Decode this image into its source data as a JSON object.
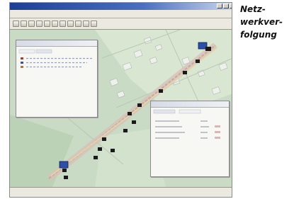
{
  "caption": {
    "lines": [
      "Netz-",
      "werkver-",
      "folgung"
    ]
  },
  "window": {
    "title": "",
    "menu": [
      "",
      "",
      ""
    ],
    "status": ""
  },
  "left_panel": {
    "title": "",
    "footer": ""
  },
  "right_panel": {
    "title": "",
    "rows": [
      "",
      "",
      "",
      ""
    ]
  },
  "colors": {
    "titlebar": "#1c3f94",
    "map_base": "#c9dbc4",
    "route": "#c9a8a0",
    "node": "#1a1a1a",
    "endpoint": "#2c4fa8"
  },
  "icons": [
    "minimize-icon",
    "maximize-icon",
    "close-icon",
    "toolbar-tool-icon",
    "server-icon",
    "router-icon"
  ]
}
